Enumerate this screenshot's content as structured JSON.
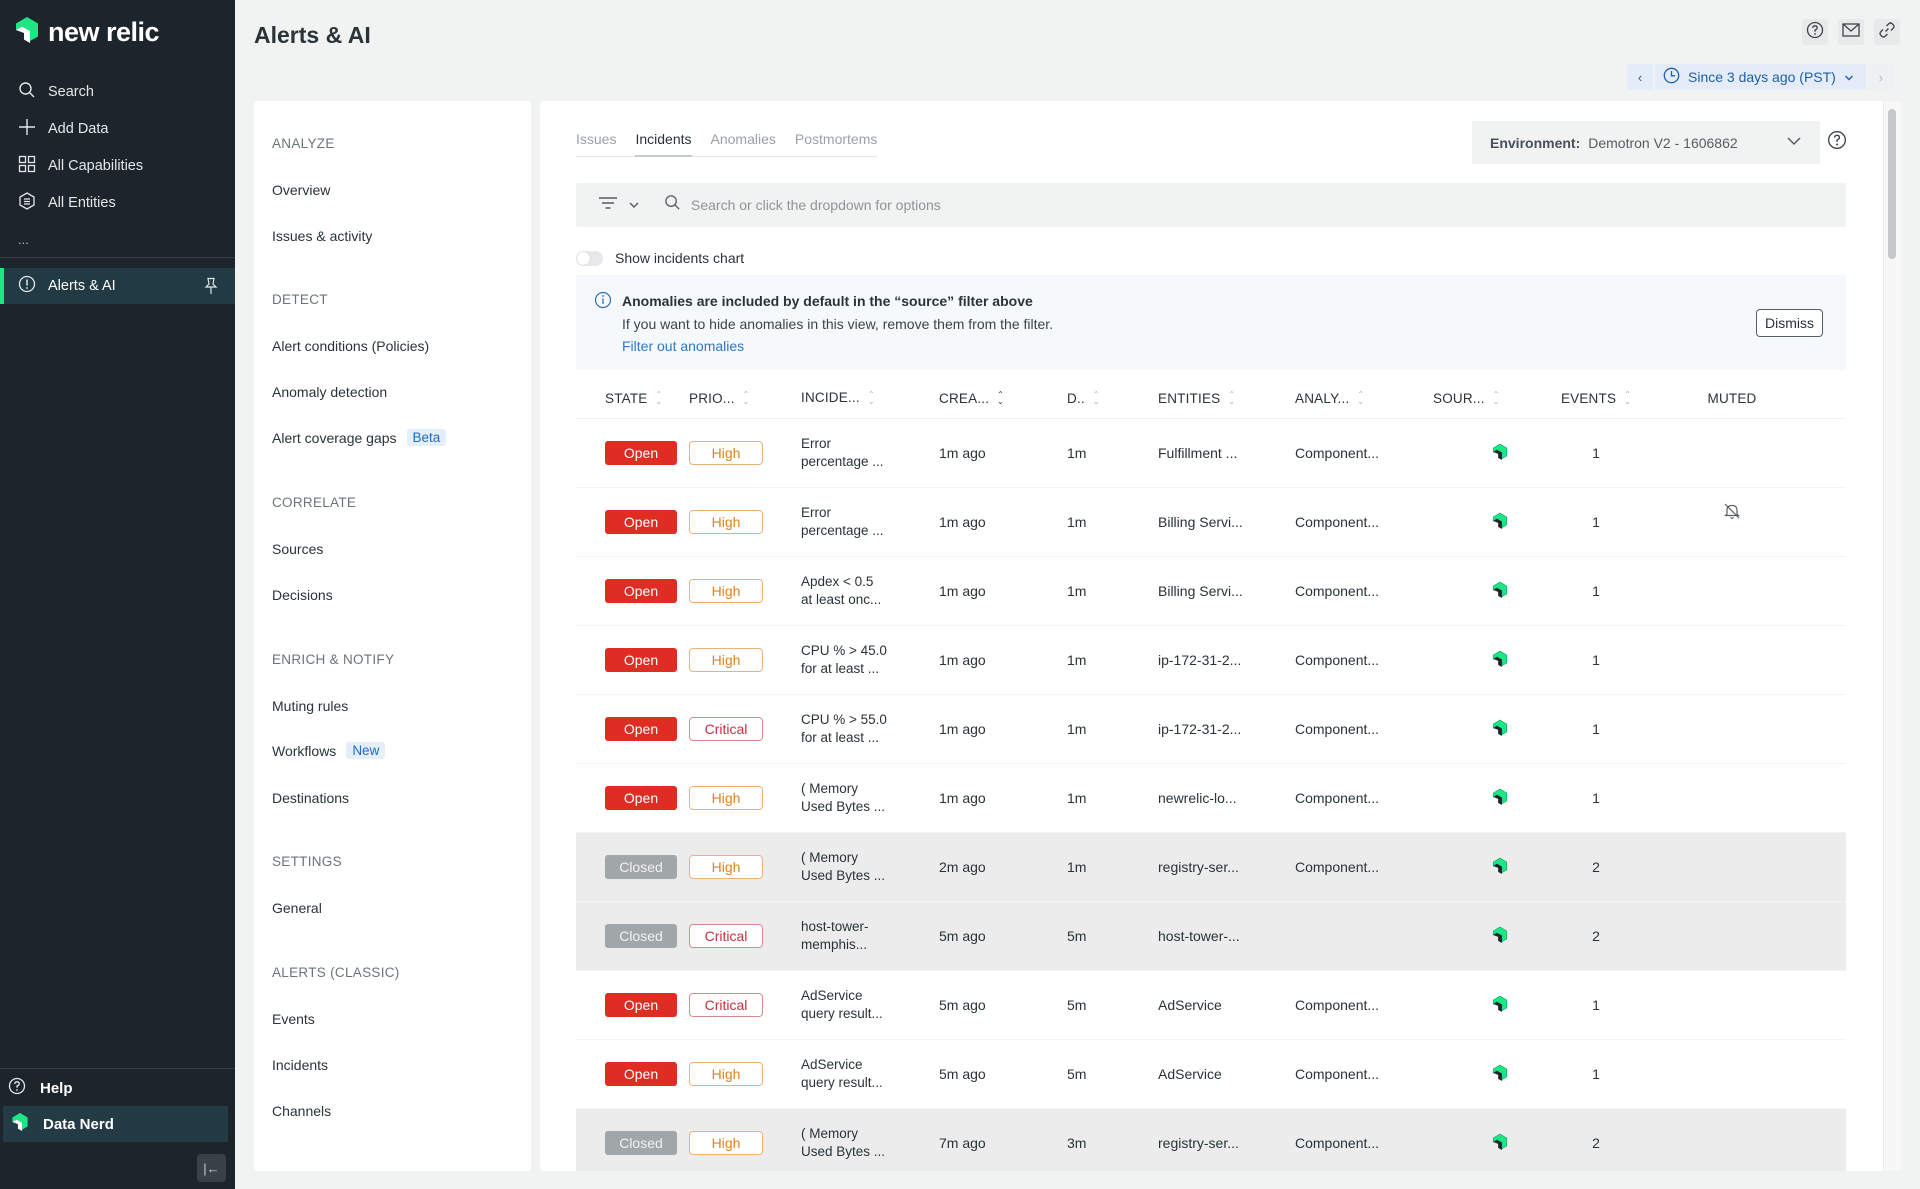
{
  "nav": {
    "logo_text": "new relic",
    "items": [
      {
        "label": "Search",
        "icon": "search-icon"
      },
      {
        "label": "Add Data",
        "icon": "plus-icon"
      },
      {
        "label": "All Capabilities",
        "icon": "grid-icon"
      },
      {
        "label": "All Entities",
        "icon": "entities-icon"
      }
    ],
    "more_label": "...",
    "active_item": {
      "label": "Alerts & AI",
      "icon": "alert-icon"
    },
    "help_label": "Help",
    "user_label": "Data Nerd"
  },
  "header": {
    "title": "Alerts & AI",
    "time_range": "Since 3 days ago (PST)"
  },
  "submenu": {
    "sections": [
      {
        "heading": "ANALYZE",
        "items": [
          {
            "label": "Overview"
          },
          {
            "label": "Issues & activity"
          }
        ]
      },
      {
        "heading": "DETECT",
        "items": [
          {
            "label": "Alert conditions (Policies)"
          },
          {
            "label": "Anomaly detection"
          },
          {
            "label": "Alert coverage gaps",
            "badge": "Beta"
          }
        ]
      },
      {
        "heading": "CORRELATE",
        "items": [
          {
            "label": "Sources"
          },
          {
            "label": "Decisions"
          }
        ]
      },
      {
        "heading": "ENRICH & NOTIFY",
        "items": [
          {
            "label": "Muting rules"
          },
          {
            "label": "Workflows",
            "badge": "New"
          },
          {
            "label": "Destinations"
          }
        ]
      },
      {
        "heading": "SETTINGS",
        "items": [
          {
            "label": "General"
          }
        ]
      },
      {
        "heading": "ALERTS (CLASSIC)",
        "items": [
          {
            "label": "Events"
          },
          {
            "label": "Incidents"
          },
          {
            "label": "Channels"
          }
        ]
      }
    ]
  },
  "main": {
    "tabs": [
      {
        "label": "Issues",
        "active": false
      },
      {
        "label": "Incidents",
        "active": true
      },
      {
        "label": "Anomalies",
        "active": false
      },
      {
        "label": "Postmortems",
        "active": false
      }
    ],
    "environment": {
      "label": "Environment:",
      "value": "Demotron V2 - 1606862"
    },
    "search": {
      "placeholder": "Search or click the dropdown for options",
      "value": ""
    },
    "toggle": {
      "label": "Show incidents chart",
      "on": false
    },
    "banner": {
      "title": "Anomalies are included by default in the “source” filter above",
      "body": "If you want to hide anomalies in this view, remove them from the filter.",
      "link": "Filter out anomalies",
      "dismiss_label": "Dismiss"
    },
    "table": {
      "columns": [
        "STATE",
        "PRIO...",
        "INCIDE...",
        "CREA...",
        "D..",
        "ENTITIES",
        "ANALY...",
        "SOUR...",
        "EVENTS",
        "MUTED"
      ],
      "rows": [
        {
          "state": "Open",
          "priority": "High",
          "incident_1": "Error",
          "incident_2": "percentage ...",
          "created": "1m ago",
          "duration": "1m",
          "entities": "Fulfillment ...",
          "analysis": "Component...",
          "source": "new-relic-icon",
          "events": "1",
          "muted": false
        },
        {
          "state": "Open",
          "priority": "High",
          "incident_1": "Error",
          "incident_2": "percentage ...",
          "created": "1m ago",
          "duration": "1m",
          "entities": "Billing Servi...",
          "analysis": "Component...",
          "source": "new-relic-icon",
          "events": "1",
          "muted": true
        },
        {
          "state": "Open",
          "priority": "High",
          "incident_1": "Apdex < 0.5",
          "incident_2": "at least onc...",
          "created": "1m ago",
          "duration": "1m",
          "entities": "Billing Servi...",
          "analysis": "Component...",
          "source": "new-relic-icon",
          "events": "1",
          "muted": false
        },
        {
          "state": "Open",
          "priority": "High",
          "incident_1": "CPU % > 45.0",
          "incident_2": "for at least ...",
          "created": "1m ago",
          "duration": "1m",
          "entities": "ip-172-31-2...",
          "analysis": "Component...",
          "source": "new-relic-icon",
          "events": "1",
          "muted": false
        },
        {
          "state": "Open",
          "priority": "Critical",
          "incident_1": "CPU % > 55.0",
          "incident_2": "for at least ...",
          "created": "1m ago",
          "duration": "1m",
          "entities": "ip-172-31-2...",
          "analysis": "Component...",
          "source": "new-relic-icon",
          "events": "1",
          "muted": false
        },
        {
          "state": "Open",
          "priority": "High",
          "incident_1": "( Memory",
          "incident_2": "Used Bytes ...",
          "created": "1m ago",
          "duration": "1m",
          "entities": "newrelic-lo...",
          "analysis": "Component...",
          "source": "new-relic-icon",
          "events": "1",
          "muted": false
        },
        {
          "state": "Closed",
          "priority": "High",
          "incident_1": "( Memory",
          "incident_2": "Used Bytes ...",
          "created": "2m ago",
          "duration": "1m",
          "entities": "registry-ser...",
          "analysis": "Component...",
          "source": "new-relic-icon",
          "events": "2",
          "muted": false
        },
        {
          "state": "Closed",
          "priority": "Critical",
          "incident_1": "host-tower-",
          "incident_2": "memphis...",
          "created": "5m ago",
          "duration": "5m",
          "entities": "host-tower-...",
          "analysis": "",
          "source": "new-relic-icon",
          "events": "2",
          "muted": false
        },
        {
          "state": "Open",
          "priority": "Critical",
          "incident_1": "AdService",
          "incident_2": "query result...",
          "created": "5m ago",
          "duration": "5m",
          "entities": "AdService",
          "analysis": "Component...",
          "source": "new-relic-icon",
          "events": "1",
          "muted": false
        },
        {
          "state": "Open",
          "priority": "High",
          "incident_1": "AdService",
          "incident_2": "query result...",
          "created": "5m ago",
          "duration": "5m",
          "entities": "AdService",
          "analysis": "Component...",
          "source": "new-relic-icon",
          "events": "1",
          "muted": false
        },
        {
          "state": "Closed",
          "priority": "High",
          "incident_1": "( Memory",
          "incident_2": "Used Bytes ...",
          "created": "7m ago",
          "duration": "3m",
          "entities": "registry-ser...",
          "analysis": "Component...",
          "source": "new-relic-icon",
          "events": "2",
          "muted": false
        }
      ]
    }
  },
  "colors": {
    "brand_green": "#1ce783",
    "nav_bg": "#1d252c",
    "state_open": "#df2d24",
    "state_closed": "#a1a6a9",
    "priority_high": "#e0821e",
    "priority_critical": "#c9303e",
    "link_blue": "#2f78c4"
  }
}
